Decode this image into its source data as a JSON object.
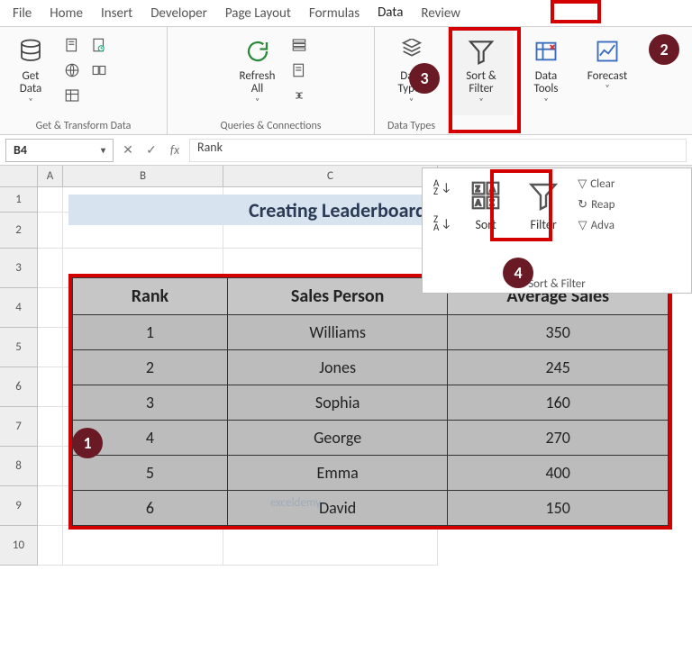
{
  "tabs": [
    "File",
    "Home",
    "Insert",
    "Developer",
    "Page Layout",
    "Formulas",
    "Data",
    "Review"
  ],
  "active_tab_index": 6,
  "ribbon": {
    "get_data": "Get\nData",
    "group_get_transform": "Get & Transform Data",
    "refresh_all": "Refresh\nAll",
    "group_queries": "Queries & Connections",
    "data_types": "Data\nTypes",
    "group_data_types": "Data Types",
    "sort_filter": "Sort &\nFilter",
    "data_tools": "Data\nTools",
    "forecast": "Forecast"
  },
  "dropdown": {
    "sort_az": "A→Z",
    "sort_za": "Z→A",
    "sort": "Sort",
    "filter": "Filter",
    "clear": "Clear",
    "reapply": "Reap",
    "advanced": "Adva",
    "footer": "Sort & Filter"
  },
  "formula": {
    "name": "B4",
    "value": "Rank"
  },
  "columns": [
    "A",
    "B",
    "C"
  ],
  "row_numbers": [
    1,
    2,
    3,
    4,
    5,
    6,
    7,
    8,
    9,
    10
  ],
  "title": "Creating Leaderboard in Excel",
  "table": {
    "headers": [
      "Rank",
      "Sales Person",
      "Average Sales"
    ],
    "rows": [
      [
        1,
        "Williams",
        350
      ],
      [
        2,
        "Jones",
        245
      ],
      [
        3,
        "Sophia",
        160
      ],
      [
        4,
        "George",
        270
      ],
      [
        5,
        "Emma",
        400
      ],
      [
        6,
        "David",
        150
      ]
    ]
  },
  "watermark": "exceldemy",
  "annotations": {
    "n1": "1",
    "n2": "2",
    "n3": "3",
    "n4": "4"
  },
  "chev": "˅"
}
